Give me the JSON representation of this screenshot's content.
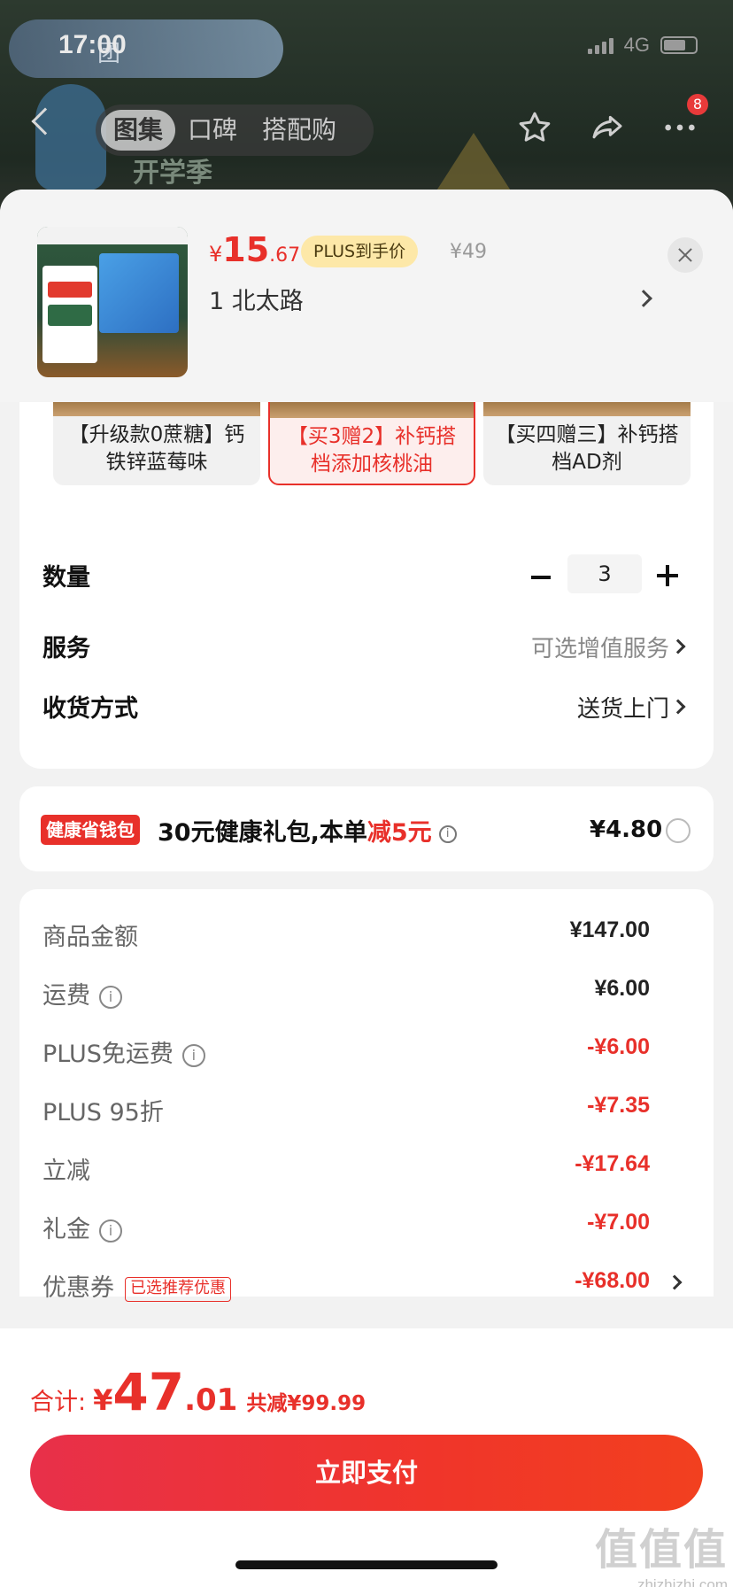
{
  "status_bar": {
    "time": "17:00",
    "network": "4G"
  },
  "background": {
    "ad_text": "团",
    "season": "开学季"
  },
  "nav": {
    "tabs": [
      {
        "label": "图集",
        "active": true
      },
      {
        "label": "口碑",
        "active": false
      },
      {
        "label": "搭配购",
        "active": false
      }
    ],
    "badge_count": "8"
  },
  "product": {
    "price_symbol": "¥",
    "price_int": "15",
    "price_dec": ".67",
    "plus_tag": "PLUS到手价",
    "original_price": "¥49",
    "address": "1 北太路"
  },
  "variants": [
    {
      "label": "【升级款0蔗糖】钙铁锌蓝莓味",
      "selected": false
    },
    {
      "label": "【买3赠2】补钙搭档添加核桃油",
      "selected": true
    },
    {
      "label": "【买四赠三】补钙搭档AD剂",
      "selected": false
    }
  ],
  "options": {
    "quantity_label": "数量",
    "quantity_value": "3",
    "service_label": "服务",
    "service_value": "可选增值服务",
    "delivery_label": "收货方式",
    "delivery_value": "送货上门"
  },
  "wallet": {
    "tag": "健康省钱包",
    "text_prefix": "30元健康礼包,本单",
    "text_highlight": "减5元",
    "price": "¥4.80"
  },
  "summary": {
    "rows": [
      {
        "label": "商品金额",
        "value": "¥147.00"
      },
      {
        "label": "运费",
        "value": "¥6.00"
      },
      {
        "label": "PLUS免运费",
        "value": "-¥6.00"
      },
      {
        "label": "PLUS 95折",
        "value": "-¥7.35"
      },
      {
        "label": "立减",
        "value": "-¥17.64"
      },
      {
        "label": "礼金",
        "value": "-¥7.00"
      },
      {
        "label": "优惠券",
        "value": "-¥68.00",
        "tag": "已选推荐优惠"
      }
    ]
  },
  "footer": {
    "total_label": "合计:",
    "total_symbol": "¥",
    "total_int": "47",
    "total_dec": ".01",
    "total_saved": "共减¥99.99",
    "pay_button": "立即支付"
  },
  "watermark": {
    "big": "值值值",
    "small": "zhizhizhi.com"
  },
  "colors": {
    "accent": "#e8302a",
    "plus_tag_bg": "#fde8a8"
  }
}
